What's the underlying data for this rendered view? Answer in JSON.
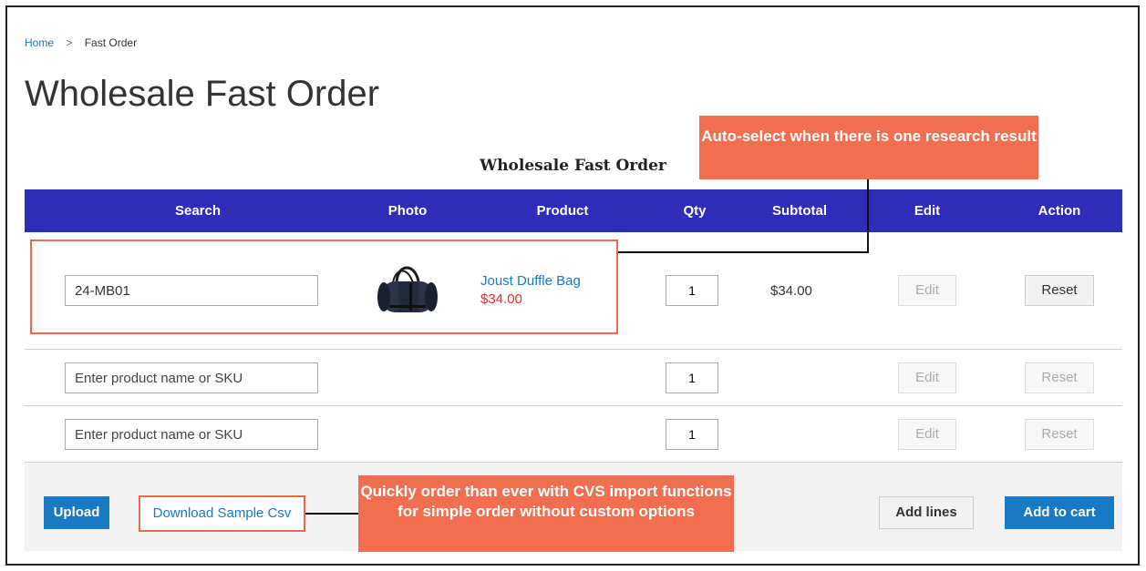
{
  "breadcrumb": {
    "home": "Home",
    "separator": ">",
    "current": "Fast Order"
  },
  "page_title": "Wholesale Fast Order",
  "table_title": "Wholesale Fast Order",
  "columns": {
    "search": "Search",
    "photo": "Photo",
    "product": "Product",
    "qty": "Qty",
    "subtotal": "Subtotal",
    "edit": "Edit",
    "action": "Action"
  },
  "rows": [
    {
      "search_value": "24-MB01",
      "product_name": "Joust Duffle Bag",
      "product_price": "$34.00",
      "qty": "1",
      "subtotal": "$34.00",
      "edit_label": "Edit",
      "reset_label": "Reset"
    },
    {
      "search_placeholder": "Enter product name or SKU",
      "qty": "1",
      "edit_label": "Edit",
      "reset_label": "Reset"
    },
    {
      "search_placeholder": "Enter product name or SKU",
      "qty": "1",
      "edit_label": "Edit",
      "reset_label": "Reset"
    }
  ],
  "footer": {
    "upload_label": "Upload",
    "download_label": "Download Sample Csv",
    "add_lines_label": "Add lines",
    "add_to_cart_label": "Add to cart"
  },
  "callouts": {
    "auto_select": "Auto-select when there is one research result",
    "csv_import": "Quickly order than ever with CVS import functions for simple order without custom options"
  },
  "colors": {
    "header_bg": "#2d2db7",
    "primary_button": "#1979c3",
    "link": "#1979c3",
    "price": "#e02b27",
    "callout": "#f26e50"
  },
  "icons": {
    "product_photo": "duffle-bag-photo"
  }
}
